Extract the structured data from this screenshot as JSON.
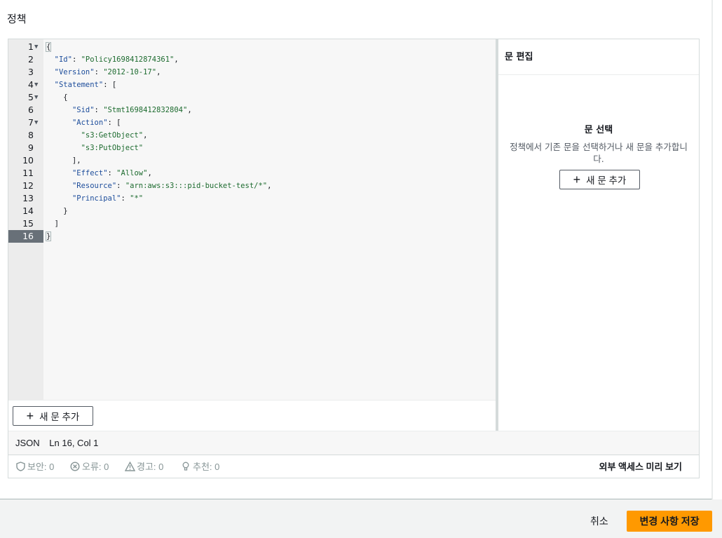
{
  "page": {
    "title": "정책"
  },
  "editor": {
    "lines": [
      {
        "n": "1",
        "fold": true,
        "segments": [
          {
            "t": "{",
            "c": "p",
            "cursor": true
          }
        ]
      },
      {
        "n": "2",
        "fold": false,
        "segments": [
          {
            "t": "  "
          },
          {
            "t": "\"Id\"",
            "c": "k"
          },
          {
            "t": ": "
          },
          {
            "t": "\"Policy1698412874361\"",
            "c": "s"
          },
          {
            "t": ","
          }
        ]
      },
      {
        "n": "3",
        "fold": false,
        "segments": [
          {
            "t": "  "
          },
          {
            "t": "\"Version\"",
            "c": "k"
          },
          {
            "t": ": "
          },
          {
            "t": "\"2012-10-17\"",
            "c": "s"
          },
          {
            "t": ","
          }
        ]
      },
      {
        "n": "4",
        "fold": true,
        "segments": [
          {
            "t": "  "
          },
          {
            "t": "\"Statement\"",
            "c": "k"
          },
          {
            "t": ": ["
          }
        ]
      },
      {
        "n": "5",
        "fold": true,
        "segments": [
          {
            "t": "    {"
          }
        ]
      },
      {
        "n": "6",
        "fold": false,
        "segments": [
          {
            "t": "      "
          },
          {
            "t": "\"Sid\"",
            "c": "k"
          },
          {
            "t": ": "
          },
          {
            "t": "\"Stmt1698412832804\"",
            "c": "s"
          },
          {
            "t": ","
          }
        ]
      },
      {
        "n": "7",
        "fold": true,
        "segments": [
          {
            "t": "      "
          },
          {
            "t": "\"Action\"",
            "c": "k"
          },
          {
            "t": ": ["
          }
        ]
      },
      {
        "n": "8",
        "fold": false,
        "segments": [
          {
            "t": "        "
          },
          {
            "t": "\"s3:GetObject\"",
            "c": "s"
          },
          {
            "t": ","
          }
        ]
      },
      {
        "n": "9",
        "fold": false,
        "segments": [
          {
            "t": "        "
          },
          {
            "t": "\"s3:PutObject\"",
            "c": "s"
          }
        ]
      },
      {
        "n": "10",
        "fold": false,
        "segments": [
          {
            "t": "      ],"
          }
        ]
      },
      {
        "n": "11",
        "fold": false,
        "segments": [
          {
            "t": "      "
          },
          {
            "t": "\"Effect\"",
            "c": "k"
          },
          {
            "t": ": "
          },
          {
            "t": "\"Allow\"",
            "c": "s"
          },
          {
            "t": ","
          }
        ]
      },
      {
        "n": "12",
        "fold": false,
        "segments": [
          {
            "t": "      "
          },
          {
            "t": "\"Resource\"",
            "c": "k"
          },
          {
            "t": ": "
          },
          {
            "t": "\"arn:aws:s3:::pid-bucket-test/*\"",
            "c": "s"
          },
          {
            "t": ","
          }
        ]
      },
      {
        "n": "13",
        "fold": false,
        "segments": [
          {
            "t": "      "
          },
          {
            "t": "\"Principal\"",
            "c": "k"
          },
          {
            "t": ": "
          },
          {
            "t": "\"*\"",
            "c": "s"
          }
        ]
      },
      {
        "n": "14",
        "fold": false,
        "segments": [
          {
            "t": "    }"
          }
        ]
      },
      {
        "n": "15",
        "fold": false,
        "segments": [
          {
            "t": "  ]"
          }
        ]
      },
      {
        "n": "16",
        "fold": false,
        "active": true,
        "segments": [
          {
            "t": "}",
            "c": "p",
            "cursor": true
          }
        ]
      }
    ],
    "add_statement_label": "새 문 추가"
  },
  "side_panel": {
    "header": "문 편집",
    "title": "문 선택",
    "description": "정책에서 기존 문을 선택하거나 새 문을 추가합니다.",
    "add_statement_label": "새 문 추가"
  },
  "status": {
    "language": "JSON",
    "position": "Ln 16, Col 1"
  },
  "issues": {
    "security": "보안: 0",
    "errors": "오류: 0",
    "warnings": "경고: 0",
    "suggestions": "추천: 0",
    "preview_label": "외부 액세스 미리 보기"
  },
  "footer": {
    "cancel_label": "취소",
    "save_label": "변경 사항 저장"
  },
  "colors": {
    "accent": "#ff9900",
    "json_key": "#1d4d9b",
    "json_string": "#1d6b2f"
  }
}
